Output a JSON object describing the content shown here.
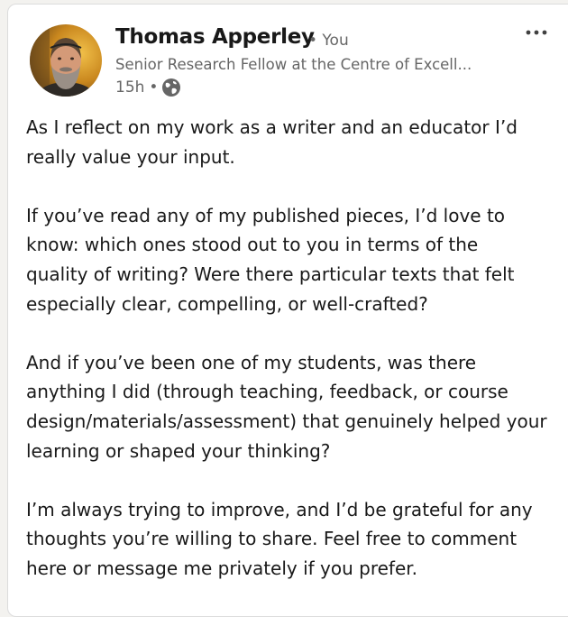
{
  "post": {
    "author": {
      "name": "Thomas Apperley",
      "you_tag": "• You",
      "headline": "Senior Research Fellow at the Centre of Excell...",
      "timestamp": "15h",
      "timestamp_sep": "•",
      "visibility_icon": "globe-icon",
      "avatar_icon": "avatar-photo"
    },
    "menu_icon": "more-options-icon",
    "body": {
      "p1": {
        "line1": "As I reflect on my work as a writer and an educator I’d",
        "line2": "really value your input."
      },
      "p2": {
        "line1": "If you’ve read any of my published pieces, I’d love to",
        "line2": "know: which ones stood out to you in terms of the",
        "line3": "quality of writing? Were there particular texts that felt",
        "line4": "especially clear, compelling, or well-crafted?"
      },
      "p3": {
        "line1": "And if you’ve been one of my students, was there",
        "line2": "anything I did (through teaching, feedback, or course",
        "line3": "design/materials/assessment) that genuinely helped your",
        "line4": "learning or shaped your thinking?"
      },
      "p4": {
        "line1": "I’m always trying to improve, and I’d be grateful for any",
        "line2": "thoughts you’re willing to share. Feel free to comment",
        "line3": "here or message me privately if you prefer."
      }
    }
  },
  "colors": {
    "page_bg": "#f3f2ef",
    "card_bg": "#ffffff",
    "text_primary": "#191919",
    "text_secondary": "#666666"
  }
}
